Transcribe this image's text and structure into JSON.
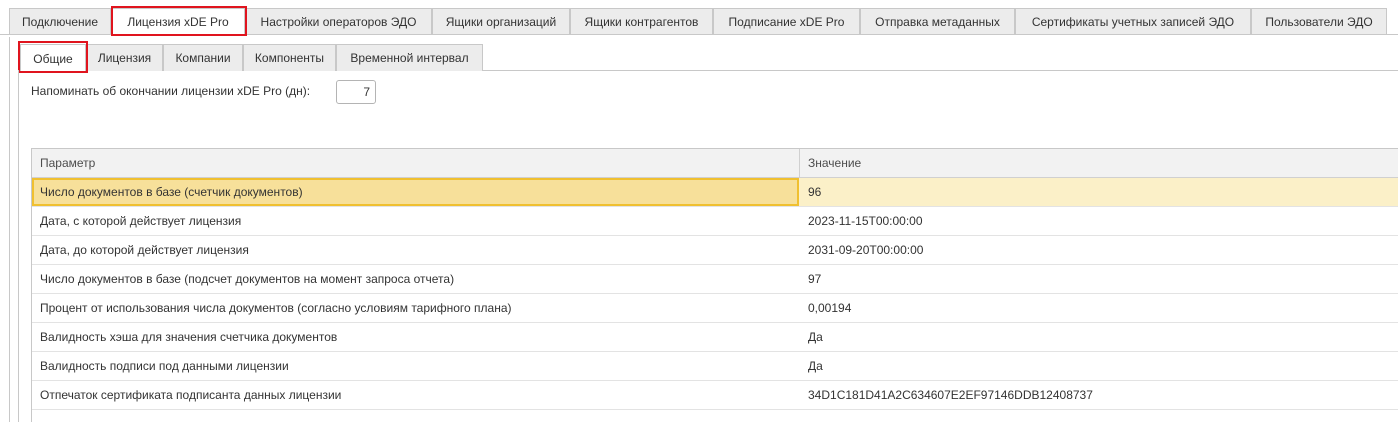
{
  "top_tabs": [
    {
      "label": "Подключение",
      "active": false
    },
    {
      "label": "Лицензия xDE Pro",
      "active": true
    },
    {
      "label": "Настройки операторов ЭДО",
      "active": false
    },
    {
      "label": "Ящики организаций",
      "active": false
    },
    {
      "label": "Ящики контрагентов",
      "active": false
    },
    {
      "label": "Подписание xDE Pro",
      "active": false
    },
    {
      "label": "Отправка метаданных",
      "active": false
    },
    {
      "label": "Сертификаты учетных записей ЭДО",
      "active": false
    },
    {
      "label": "Пользователи ЭДО",
      "active": false
    }
  ],
  "sub_tabs": [
    {
      "label": "Общие",
      "active": true
    },
    {
      "label": "Лицензия",
      "active": false
    },
    {
      "label": "Компании",
      "active": false
    },
    {
      "label": "Компоненты",
      "active": false
    },
    {
      "label": "Временной интервал",
      "active": false
    }
  ],
  "reminder": {
    "label": "Напоминать об окончании лицензии xDE Pro (дн):",
    "value": "7"
  },
  "table": {
    "columns": [
      "Параметр",
      "Значение"
    ],
    "rows": [
      {
        "param": "Число документов в базе (счетчик документов)",
        "value": "96",
        "selected": true
      },
      {
        "param": "Дата, с которой действует лицензия",
        "value": "2023-11-15T00:00:00"
      },
      {
        "param": "Дата, до которой действует лицензия",
        "value": "2031-09-20T00:00:00"
      },
      {
        "param": "Число документов в базе (подсчет документов на момент запроса отчета)",
        "value": "97"
      },
      {
        "param": "Процент от использования числа документов (согласно условиям тарифного плана)",
        "value": "0,00194"
      },
      {
        "param": "Валидность хэша для значения счетчика документов",
        "value": "Да"
      },
      {
        "param": "Валидность подписи под данными лицензии",
        "value": "Да"
      },
      {
        "param": "Отпечаток сертификата подписанта данных лицензии",
        "value": "34D1C181D41A2C634607E2EF97146DDB12408737"
      }
    ]
  },
  "colors": {
    "highlight_border": "#e0141e",
    "selected_row": "#fbf0c8",
    "selected_cell_border": "#f0c030"
  }
}
